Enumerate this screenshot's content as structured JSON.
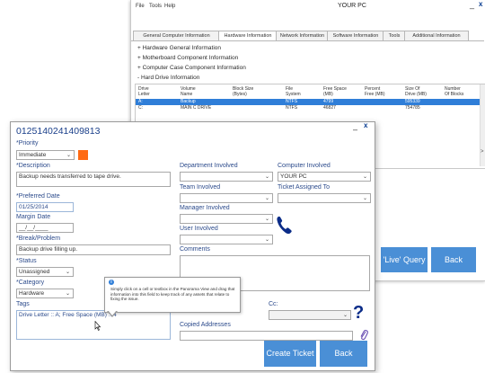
{
  "back_window": {
    "menu": [
      "File",
      "Tools",
      "Help"
    ],
    "title": "YOUR PC",
    "tabs": [
      "General Computer Information",
      "Hardware Information",
      "Network Information",
      "Software Information",
      "Tools",
      "Additional Information"
    ],
    "active_tab": "Hardware Information",
    "info_items": [
      "+ Hardware General Information",
      "+ Motherboard Component Information",
      "+ Computer Case Component Information",
      "- Hard Drive Information"
    ],
    "table": {
      "headers": [
        [
          "Drive",
          "Letter"
        ],
        [
          "Volume",
          "Name"
        ],
        [
          "Block Size",
          "(Bytes)"
        ],
        [
          "File",
          "System"
        ],
        [
          "Free Space",
          "(MB)"
        ],
        [
          "Percent",
          "Free (MB)"
        ],
        [
          "Size Of",
          "Drive (MB)"
        ],
        [
          "Number",
          "Of Blocks"
        ]
      ],
      "rows": [
        [
          "A:",
          "Backup",
          "",
          "NTFS",
          "4799",
          "",
          "595339",
          ""
        ],
        [
          "C:",
          "MAIN C DRIVE",
          "",
          "NTFS",
          "46827",
          "",
          "754785",
          ""
        ]
      ],
      "selected_row": 0
    },
    "buttons": {
      "query": "'Live' Query",
      "back": "Back"
    }
  },
  "ticket": {
    "number": "0125140241409813",
    "priority_label": "*Priority",
    "priority_value": "Immediate",
    "priority_color": "#ff6a13",
    "description_label": "*Description",
    "description_value": "Backup needs transferred to tape drive.",
    "preferred_date_label": "*Preferred Date",
    "preferred_date_value": "01/25/2014",
    "margin_date_label": "Margin Date",
    "margin_date_value": "__/__/____",
    "break_label": "*Break/Problem",
    "break_value": "Backup drive filling up.",
    "status_label": "*Status",
    "status_value": "Unassigned",
    "category_label": "*Category",
    "category_value": "Hardware",
    "tags_label": "Tags",
    "tags_value": "Drive Letter :: A; Free Space (MB) :: 4",
    "department_label": "Department Involved",
    "team_label": "Team Involved",
    "manager_label": "Manager Involved",
    "user_label": "User Involved",
    "comments_label": "Comments",
    "computer_label": "Computer Involved",
    "computer_value": "YOUR PC",
    "ticket_assigned_label": "Ticket Assigned To",
    "cc_label": "Cc:",
    "copied_label": "Copied Addresses",
    "buttons": {
      "create": "Create Ticket",
      "back": "Back"
    }
  },
  "tooltip": {
    "text": "Simply click on a cell or textbox in the Panorama View and drag that information into this field to keep track of any assets that relate to fixing the issue."
  },
  "icons": [
    "info-icon",
    "phone-icon",
    "help-icon",
    "paperclip-icon",
    "chevron-down-icon",
    "close-icon",
    "minimize-icon",
    "cursor-icon"
  ]
}
